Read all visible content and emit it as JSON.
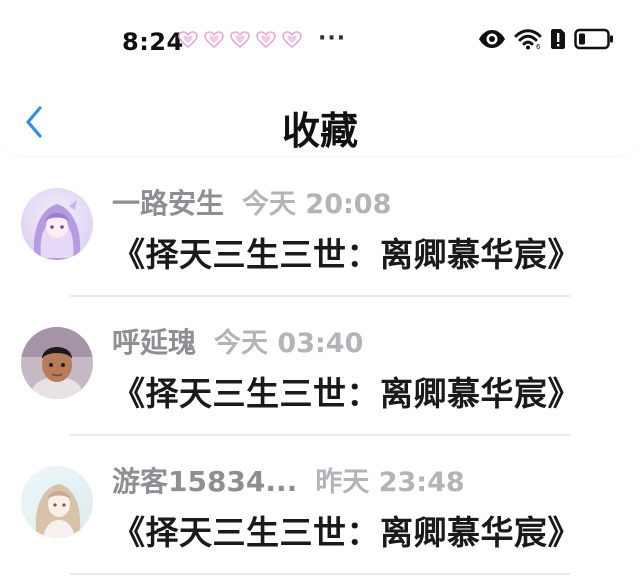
{
  "status_bar": {
    "time": "8:24",
    "more": "···"
  },
  "header": {
    "title": "收藏",
    "back_icon": "chevron-left-icon",
    "accent": "#2f8cf0"
  },
  "items": [
    {
      "username": "一路安生",
      "time": "今天 20:08",
      "title": "《择天三生三世：离卿慕华宸》",
      "avatar": "anime-girl-purple"
    },
    {
      "username": "呼延瑰",
      "time": "今天 03:40",
      "title": "《择天三生三世：离卿慕华宸》",
      "avatar": "child-photo"
    },
    {
      "username": "游客15834...",
      "time": "昨天 23:48",
      "title": "《择天三生三世：离卿慕华宸》",
      "avatar": "anime-girl-pastel"
    }
  ]
}
